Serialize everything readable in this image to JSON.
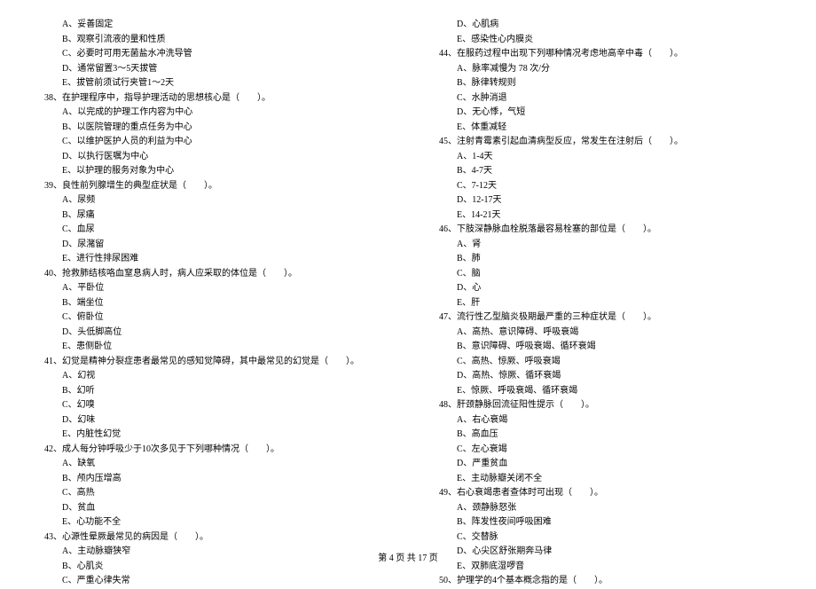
{
  "left_column": [
    {
      "type": "option",
      "text": "A、妥善固定"
    },
    {
      "type": "option",
      "text": "B、观察引流液的量和性质"
    },
    {
      "type": "option",
      "text": "C、必要时可用无菌盐水冲洗导管"
    },
    {
      "type": "option",
      "text": "D、通常留置3～5天拔管"
    },
    {
      "type": "option",
      "text": "E、拔管前须试行夹管1～2天"
    },
    {
      "type": "question",
      "text": "38、在护理程序中，指导护理活动的思想核心是（　　）。"
    },
    {
      "type": "option",
      "text": "A、以完成的护理工作内容为中心"
    },
    {
      "type": "option",
      "text": "B、以医院管理的重点任务为中心"
    },
    {
      "type": "option",
      "text": "C、以维护医护人员的利益为中心"
    },
    {
      "type": "option",
      "text": "D、以执行医嘱为中心"
    },
    {
      "type": "option",
      "text": "E、以护理的服务对象为中心"
    },
    {
      "type": "question",
      "text": "39、良性前列腺增生的典型症状是（　　）。"
    },
    {
      "type": "option",
      "text": "A、尿频"
    },
    {
      "type": "option",
      "text": "B、尿痛"
    },
    {
      "type": "option",
      "text": "C、血尿"
    },
    {
      "type": "option",
      "text": "D、尿潴留"
    },
    {
      "type": "option",
      "text": "E、进行性排尿困难"
    },
    {
      "type": "question",
      "text": "40、抢救肺结核咯血窒息病人时，病人应采取的体位是（　　）。"
    },
    {
      "type": "option",
      "text": "A、平卧位"
    },
    {
      "type": "option",
      "text": "B、端坐位"
    },
    {
      "type": "option",
      "text": "C、俯卧位"
    },
    {
      "type": "option",
      "text": "D、头低脚高位"
    },
    {
      "type": "option",
      "text": "E、患侧卧位"
    },
    {
      "type": "question",
      "text": "41、幻觉是精神分裂症患者最常见的感知觉障碍，其中最常见的幻觉是（　　）。"
    },
    {
      "type": "option",
      "text": "A、幻视"
    },
    {
      "type": "option",
      "text": "B、幻听"
    },
    {
      "type": "option",
      "text": "C、幻嗅"
    },
    {
      "type": "option",
      "text": "D、幻味"
    },
    {
      "type": "option",
      "text": "E、内脏性幻觉"
    },
    {
      "type": "question",
      "text": "42、成人每分钟呼吸少于10次多见于下列哪种情况（　　）。"
    },
    {
      "type": "option",
      "text": "A、缺氧"
    },
    {
      "type": "option",
      "text": "B、颅内压增高"
    },
    {
      "type": "option",
      "text": "C、高热"
    },
    {
      "type": "option",
      "text": "D、贫血"
    },
    {
      "type": "option",
      "text": "E、心功能不全"
    },
    {
      "type": "question",
      "text": "43、心源性晕厥最常见的病因是（　　）。"
    },
    {
      "type": "option",
      "text": "A、主动脉瓣狭窄"
    },
    {
      "type": "option",
      "text": "B、心肌炎"
    },
    {
      "type": "option",
      "text": "C、严重心律失常"
    }
  ],
  "right_column": [
    {
      "type": "option",
      "text": "D、心肌病"
    },
    {
      "type": "option",
      "text": "E、感染性心内膜炎"
    },
    {
      "type": "question",
      "text": "44、在服药过程中出现下列哪种情况考虑地高辛中毒（　　）。"
    },
    {
      "type": "option",
      "text": "A、脉率减慢为 78 次/分"
    },
    {
      "type": "option",
      "text": "B、脉律转规则"
    },
    {
      "type": "option",
      "text": "C、水肿消退"
    },
    {
      "type": "option",
      "text": "D、无心悸，气短"
    },
    {
      "type": "option",
      "text": "E、体重减轻"
    },
    {
      "type": "question",
      "text": "45、注射青霉素引起血清病型反应，常发生在注射后（　　）。"
    },
    {
      "type": "option",
      "text": "A、1-4天"
    },
    {
      "type": "option",
      "text": "B、4-7天"
    },
    {
      "type": "option",
      "text": "C、7-12天"
    },
    {
      "type": "option",
      "text": "D、12-17天"
    },
    {
      "type": "option",
      "text": "E、14-21天"
    },
    {
      "type": "question",
      "text": "46、下肢深静脉血栓脱落最容易栓塞的部位是（　　）。"
    },
    {
      "type": "option",
      "text": "A、肾"
    },
    {
      "type": "option",
      "text": "B、肺"
    },
    {
      "type": "option",
      "text": "C、脑"
    },
    {
      "type": "option",
      "text": "D、心"
    },
    {
      "type": "option",
      "text": "E、肝"
    },
    {
      "type": "question",
      "text": "47、流行性乙型脑炎极期最严重的三种症状是（　　）。"
    },
    {
      "type": "option",
      "text": "A、高热、意识障碍、呼吸衰竭"
    },
    {
      "type": "option",
      "text": "B、意识障碍、呼吸衰竭、循环衰竭"
    },
    {
      "type": "option",
      "text": "C、高热、惊厥、呼吸衰竭"
    },
    {
      "type": "option",
      "text": "D、高热、惊厥、循环衰竭"
    },
    {
      "type": "option",
      "text": "E、惊厥、呼吸衰竭、循环衰竭"
    },
    {
      "type": "question",
      "text": "48、肝颈静脉回流征阳性提示（　　）。"
    },
    {
      "type": "option",
      "text": "A、右心衰竭"
    },
    {
      "type": "option",
      "text": "B、高血压"
    },
    {
      "type": "option",
      "text": "C、左心衰竭"
    },
    {
      "type": "option",
      "text": "D、严重贫血"
    },
    {
      "type": "option",
      "text": "E、主动脉瓣关闭不全"
    },
    {
      "type": "question",
      "text": "49、右心衰竭患者查体时可出现（　　）。"
    },
    {
      "type": "option",
      "text": "A、颈静脉怒张"
    },
    {
      "type": "option",
      "text": "B、阵发性夜间呼吸困难"
    },
    {
      "type": "option",
      "text": "C、交替脉"
    },
    {
      "type": "option",
      "text": "D、心尖区舒张期奔马律"
    },
    {
      "type": "option",
      "text": "E、双肺底湿啰音"
    },
    {
      "type": "question",
      "text": "50、护理学的4个基本概念指的是（　　）。"
    }
  ],
  "footer": "第 4 页 共 17 页"
}
